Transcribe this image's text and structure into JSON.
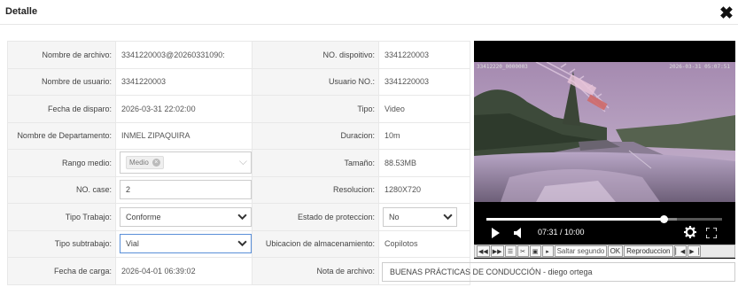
{
  "dialog": {
    "title": "Detalle",
    "close_icon": "close-icon"
  },
  "form": {
    "nombre_archivo": {
      "label": "Nombre de archivo:",
      "value": "3341220003@20260331090:"
    },
    "no_dispositivo": {
      "label": "NO. dispoitivo:",
      "value": "3341220003"
    },
    "nombre_usuario": {
      "label": "Nombre de usuario:",
      "value": "3341220003"
    },
    "usuario_no": {
      "label": "Usuario NO.:",
      "value": "3341220003"
    },
    "fecha_disparo": {
      "label": "Fecha de disparo:",
      "value": "2026-03-31 22:02:00"
    },
    "tipo": {
      "label": "Tipo:",
      "value": "Video"
    },
    "departamento": {
      "label": "Nombre de Departamento:",
      "value": "INMEL ZIPAQUIRA"
    },
    "duracion": {
      "label": "Duracion:",
      "value": "10m"
    },
    "rango_medio": {
      "label": "Rango medio:",
      "chip": "Medio"
    },
    "tamano": {
      "label": "Tamaño:",
      "value": "88.53MB"
    },
    "no_case": {
      "label": "NO. case:",
      "value": "2"
    },
    "resolucion": {
      "label": "Resolucion:",
      "value": "1280X720"
    },
    "tipo_trabajo": {
      "label": "Tipo Trabajo:",
      "value": "Conforme"
    },
    "estado_proteccion": {
      "label": "Estado de proteccion:",
      "value": "No"
    },
    "tipo_subtrabajo": {
      "label": "Tipo subtrabajo:",
      "value": "Vial"
    },
    "ubicacion": {
      "label": "Ubicacion de almacenamiento:",
      "value": "Copilotos"
    },
    "fecha_carga": {
      "label": "Fecha de carga:",
      "value": "2026-04-01 06:39:02"
    },
    "nota_archivo": {
      "label": "Nota de archivo:",
      "value": "BUENAS PRÁCTICAS DE CONDUCCIÓN - diego ortega"
    }
  },
  "player": {
    "osd_left": "33412220_0000003",
    "osd_right": "2026-03-31 05:07:51",
    "time_display": "07:31 / 10:00",
    "progress_fraction": 0.752,
    "buffered_fraction": 0.81,
    "toolbar": {
      "skip_placeholder": "Saltar segundo",
      "ok_label": "OK",
      "playback_label": "Reproduccion"
    }
  }
}
